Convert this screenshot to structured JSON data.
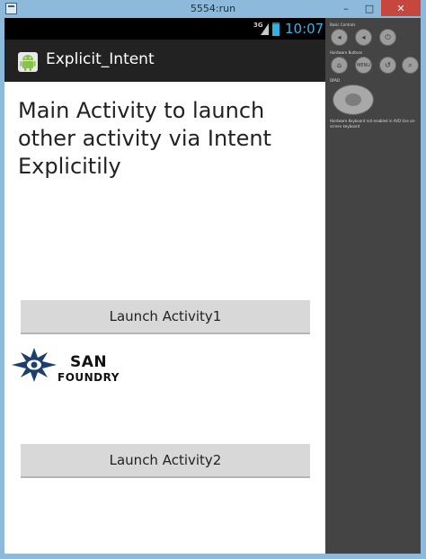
{
  "window": {
    "title": "5554:run",
    "minimize_glyph": "–",
    "maximize_glyph": "□",
    "close_glyph": "✕"
  },
  "status_bar": {
    "network": "3G",
    "time": "10:07"
  },
  "action_bar": {
    "app_icon": "android-icon",
    "title": "Explicit_Intent"
  },
  "main": {
    "heading": "Main Activity to launch other activity via Intent Explicitily",
    "button1_label": "Launch Activity1",
    "button2_label": "Launch Activity2",
    "logo": {
      "line1": "SAN",
      "line2": "FOUNDRY"
    }
  },
  "emulator_panel": {
    "basic_controls_label": "Basic Controls",
    "hardware_buttons_label": "Hardware Buttons",
    "menu_label": "MENU",
    "dpad_label": "DPAD",
    "keyboard_note": "Hardware Keyboard not enabled in AVD Use on-screen keyboard"
  },
  "colors": {
    "status_time": "#33b5e5",
    "action_bar": "#222222",
    "button_bg": "#d8d8d8",
    "panel_bg": "#444444",
    "close_button": "#c7463d"
  }
}
